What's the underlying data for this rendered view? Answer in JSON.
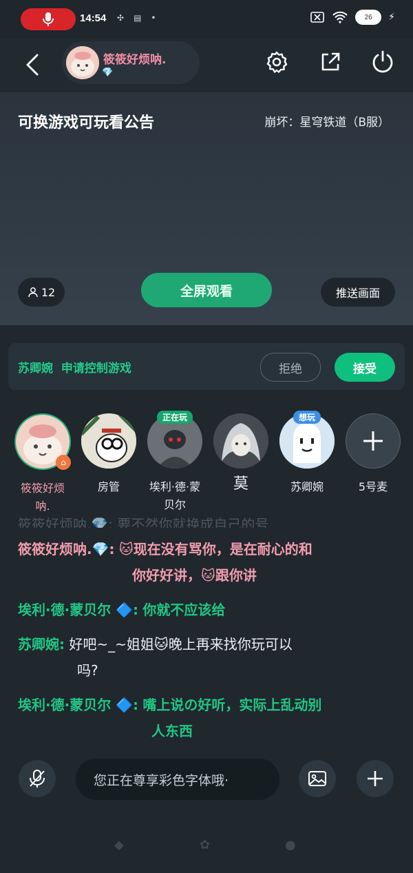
{
  "status_bar": {
    "time": "14:54",
    "battery": "26"
  },
  "top_bar": {
    "room_owner_name": "筱筱好烦呐.",
    "room_badge": "💎"
  },
  "video": {
    "title": "可换游戏可玩看公告",
    "game": "崩坏：星穹铁道（B服）",
    "viewers": "12",
    "fullscreen_label": "全屏观看",
    "push_label": "推送画面"
  },
  "control_request": {
    "text": "苏卿婉  申请控制游戏",
    "reject_label": "拒绝",
    "accept_label": "接受"
  },
  "seats": [
    {
      "name": "筱筱好烦\n呐.",
      "tag": ""
    },
    {
      "name": "房管",
      "tag": ""
    },
    {
      "name": "埃利·德·蒙\n贝尔",
      "tag": "正在玩"
    },
    {
      "name": "莫",
      "tag": ""
    },
    {
      "name": "苏卿婉",
      "tag": "想玩"
    },
    {
      "name": "5号麦",
      "tag": ""
    }
  ],
  "chat": {
    "faded_line": "筱筱好烦呐.💎: 要不然你就换成自己的号",
    "m1_sender": "筱筱好烦呐.💎:",
    "m1_text_1": "🐱现在没有骂你，是在耐心的和",
    "m1_text_2": "你好好讲，🐱跟你讲",
    "m2_sender": "埃利·德·蒙贝尔 🔷:",
    "m2_text": "你就不应该给",
    "m3_sender": "苏卿婉:",
    "m3_text_1": "好吧~_~姐姐🐱晚上再来找你玩可以",
    "m3_text_2": "吗?",
    "m4_sender": "埃利·德·蒙贝尔 🔷:",
    "m4_text_1": "嘴上说の好听，实际上乱动别",
    "m4_text_2": "人东西"
  },
  "input": {
    "placeholder": "您正在尊享彩色字体哦·"
  }
}
